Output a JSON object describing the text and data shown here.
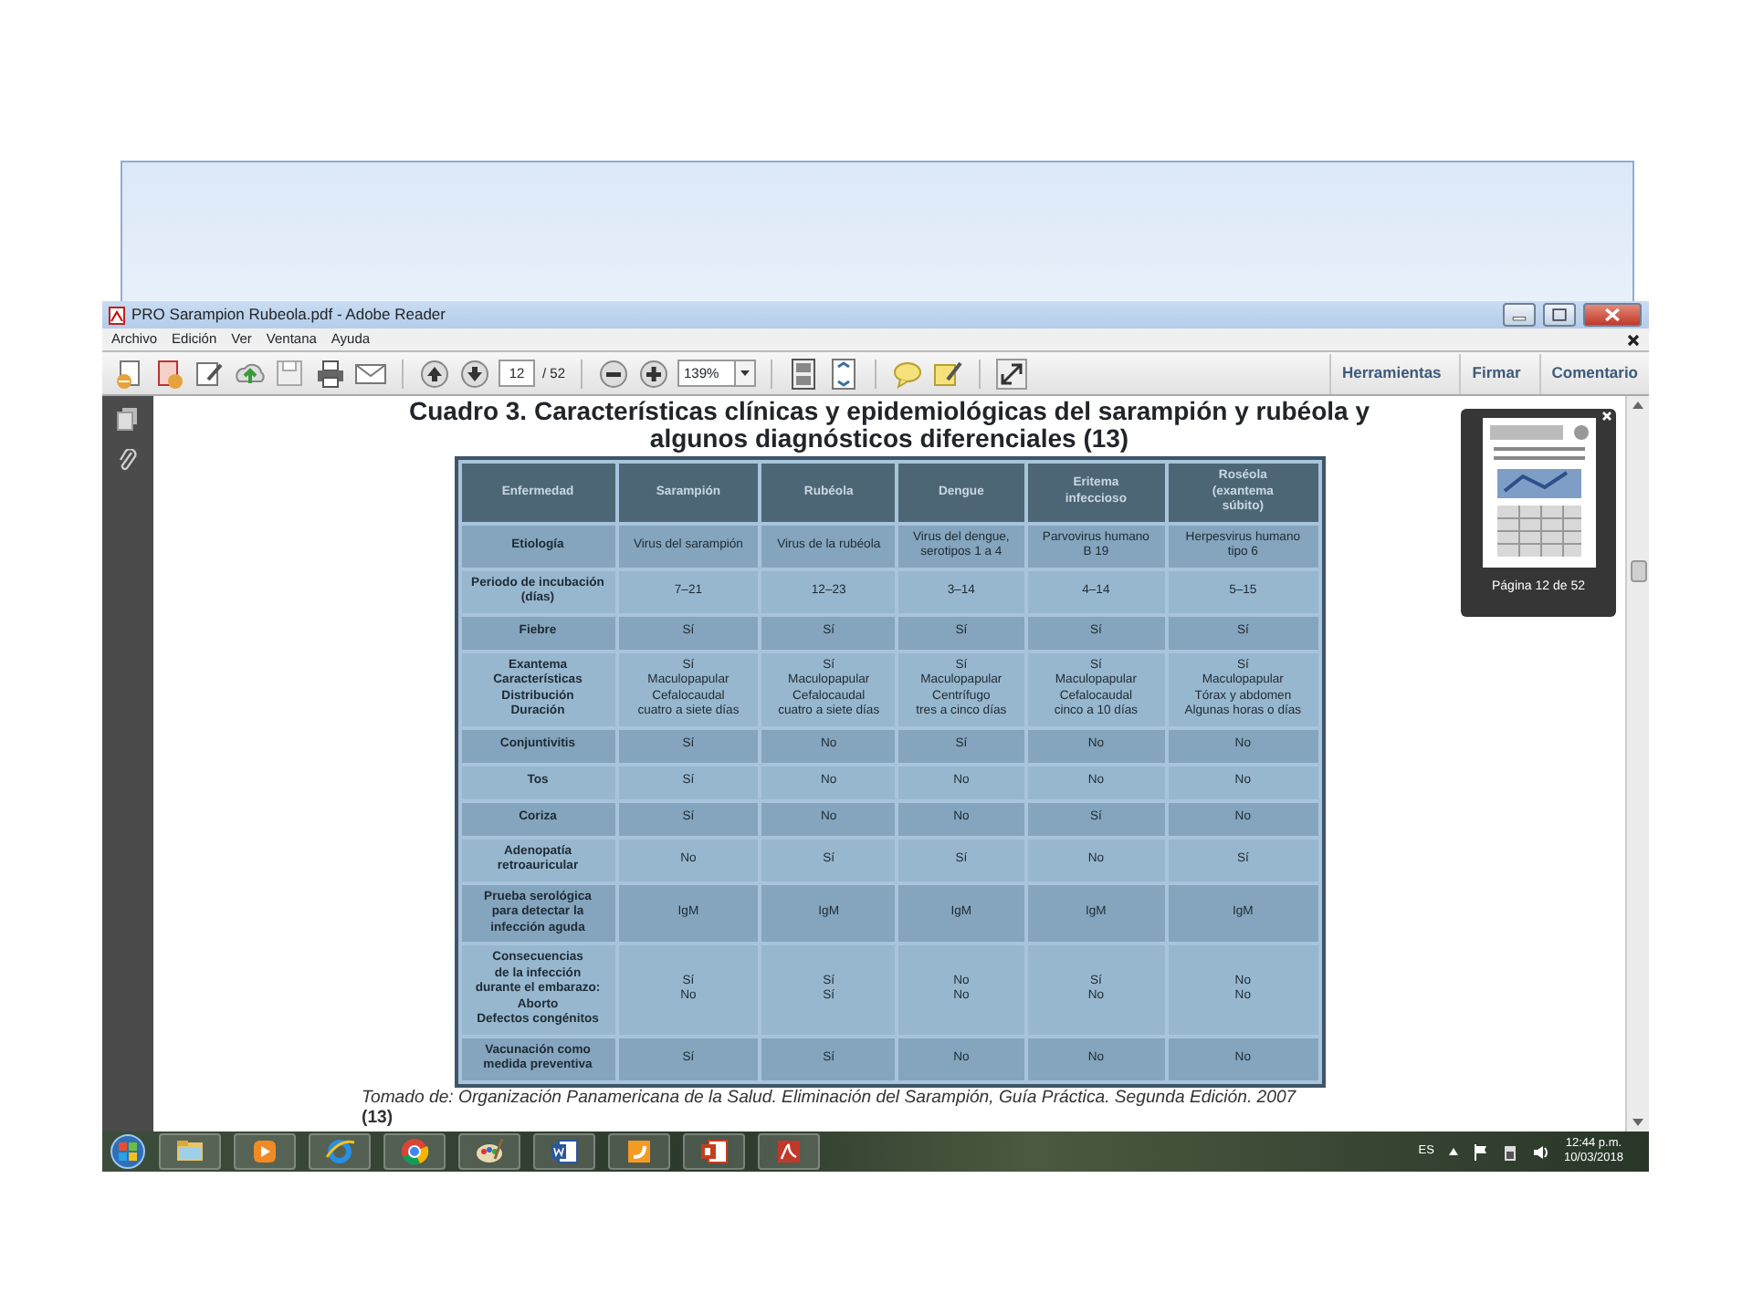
{
  "window": {
    "title": "PRO Sarampion Rubeola.pdf - Adobe Reader"
  },
  "menu": [
    "Archivo",
    "Edición",
    "Ver",
    "Ventana",
    "Ayuda"
  ],
  "toolbar": {
    "page": "12",
    "page_total": "/ 52",
    "zoom": "139%"
  },
  "panels": [
    "Herramientas",
    "Firmar",
    "Comentario"
  ],
  "document": {
    "title_lines": [
      "Cuadro 3. Características clínicas y epidemiológicas del sarampión y rubéola y",
      "algunos diagnósticos diferenciales (13)"
    ],
    "table": {
      "columns": [
        "Enfermedad",
        "Sarampión",
        "Rubéola",
        "Dengue",
        "Eritema\ninfeccioso",
        "Roséola\n(exantema\nsúbito)"
      ],
      "rows": [
        {
          "cells": [
            "Etiología",
            "Virus del sarampión",
            "Virus de la rubéola",
            "Virus del dengue,\nserotipos 1 a 4",
            "Parvovirus humano\nB 19",
            "Herpesvirus humano\ntipo 6"
          ]
        },
        {
          "cells": [
            "Periodo de incubación\n(días)",
            "7–21",
            "12–23",
            "3–14",
            "4–14",
            "5–15"
          ]
        },
        {
          "cells": [
            "Fiebre",
            "Sí",
            "Sí",
            "Sí",
            "Sí",
            "Sí"
          ]
        },
        {
          "cells": [
            "Exantema\nCaracterísticas\nDistribución\nDuración",
            "Sí\nMaculopapular\nCefalocaudal\ncuatro a siete días",
            "Sí\nMaculopapular\nCefalocaudal\ncuatro a siete días",
            "Sí\nMaculopapular\nCentrífugo\ntres a cinco días",
            "Sí\nMaculopapular\nCefalocaudal\ncinco a 10 días",
            "Sí\nMaculopapular\nTórax y abdomen\nAlgunas horas o días"
          ]
        },
        {
          "cells": [
            "Conjuntivitis",
            "Sí",
            "No",
            "Sí",
            "No",
            "No"
          ]
        },
        {
          "cells": [
            "Tos",
            "Sí",
            "No",
            "No",
            "No",
            "No"
          ]
        },
        {
          "cells": [
            "Coriza",
            "Sí",
            "No",
            "No",
            "Sí",
            "No"
          ]
        },
        {
          "cells": [
            "Adenopatía\nretroauricular",
            "No",
            "Sí",
            "Sí",
            "No",
            "Sí"
          ]
        },
        {
          "cells": [
            "Prueba serológica\npara detectar la\ninfección aguda",
            "IgM",
            "IgM",
            "IgM",
            "IgM",
            "IgM"
          ]
        },
        {
          "cells": [
            "Consecuencias\nde la infección\ndurante el embarazo:\nAborto\nDefectos congénitos",
            "Sí\nNo",
            "Sí\nSí",
            "No\nNo",
            "Sí\nNo",
            "No\nNo"
          ]
        },
        {
          "cells": [
            "Vacunación como\nmedida preventiva",
            "Sí",
            "Sí",
            "No",
            "No",
            "No"
          ]
        }
      ]
    },
    "source": [
      "Tomado de: Organización Panamericana de la Salud. Eliminación del Sarampión, Guía Práctica. Segunda Edición. 2007",
      "(13)"
    ]
  },
  "thumbnail": {
    "caption": "Página 12 de 52"
  },
  "taskbar": {
    "language": "ES",
    "time": "12:44 p.m.",
    "date": "10/03/2018"
  }
}
